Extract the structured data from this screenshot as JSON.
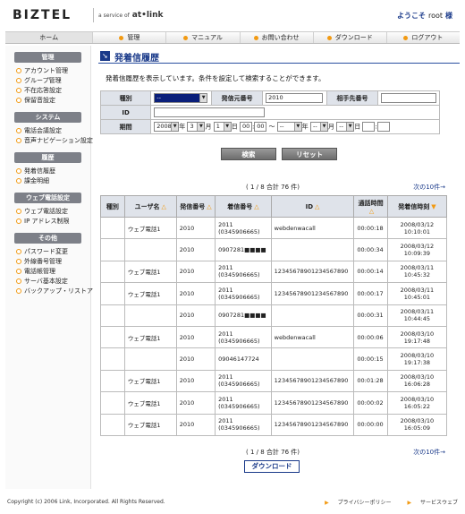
{
  "header": {
    "logo": "BIZTEL",
    "logo_sub_prefix": "a service of",
    "logo_sub_brand": "at•link",
    "welcome_prefix": "ようこそ",
    "welcome_user": "root",
    "welcome_suffix": "様"
  },
  "nav": [
    "ホーム",
    "管理",
    "マニュアル",
    "お問い合わせ",
    "ダウンロード",
    "ログアウト"
  ],
  "sidebar": {
    "sections": [
      {
        "title": "管理",
        "items": [
          "アカウント管理",
          "グループ管理",
          "不在応答設定",
          "保留音設定"
        ]
      },
      {
        "title": "システム",
        "items": [
          "電話会議設定",
          "音声ナビゲーション設定"
        ]
      },
      {
        "title": "履歴",
        "items": [
          "発着信履歴",
          "課金明細"
        ]
      },
      {
        "title": "ウェブ電話設定",
        "items": [
          "ウェブ電話設定",
          "IP アドレス制限"
        ]
      },
      {
        "title": "その他",
        "items": [
          "パスワード変更",
          "外線番号管理",
          "電話帳管理",
          "サーバ基本設定",
          "バックアップ・リストア"
        ]
      }
    ]
  },
  "page": {
    "title": "発着信履歴",
    "description": "発着信履歴を表示しています。条件を設定して検索することができます。"
  },
  "form": {
    "type_label": "種別",
    "type_value": "--",
    "caller_label": "発信元番号",
    "caller_value": "2010",
    "callee_label": "相手先番号",
    "callee_value": "",
    "id_label": "ID",
    "id_value": "",
    "period_label": "期間",
    "from_year": "2008",
    "year_unit": "年",
    "from_month": "3",
    "month_unit": "月",
    "from_day": "1",
    "day_unit": "日",
    "from_hour": "00",
    "from_min": "00",
    "time_sep": ":",
    "range_sep": "〜",
    "to_year": "--",
    "to_month": "--",
    "to_day": "--",
    "to_hour": "",
    "to_min": ""
  },
  "buttons": {
    "search": "検索",
    "reset": "リセット",
    "download": "ダウンロード"
  },
  "pagination": {
    "count": "( 1 / 8 合計 76 件)",
    "next": "次の10件→"
  },
  "table": {
    "headers": [
      "種別",
      "ユーザ名",
      "発信番号",
      "着信番号",
      "ID",
      "通話時間",
      "発着信時刻"
    ],
    "rows": [
      {
        "type": "",
        "user": "ウェブ電話1",
        "from": "2010",
        "to": "2011 (0345906665)",
        "id": "webdenwacall",
        "dur": "00:00:18",
        "time": "2008/03/12 10:10:01"
      },
      {
        "type": "",
        "user": "",
        "from": "2010",
        "to": "0907281■■■■",
        "id": "",
        "dur": "00:00:34",
        "time": "2008/03/12 10:09:39"
      },
      {
        "type": "",
        "user": "ウェブ電話1",
        "from": "2010",
        "to": "2011 (0345906665)",
        "id": "12345678901234567890",
        "dur": "00:00:14",
        "time": "2008/03/11 10:45:32"
      },
      {
        "type": "",
        "user": "ウェブ電話1",
        "from": "2010",
        "to": "2011 (0345906665)",
        "id": "12345678901234567890",
        "dur": "00:00:17",
        "time": "2008/03/11 10:45:01"
      },
      {
        "type": "",
        "user": "",
        "from": "2010",
        "to": "0907281■■■■",
        "id": "",
        "dur": "00:00:31",
        "time": "2008/03/11 10:44:45"
      },
      {
        "type": "",
        "user": "ウェブ電話1",
        "from": "2010",
        "to": "2011 (0345906665)",
        "id": "webdenwacall",
        "dur": "00:00:06",
        "time": "2008/03/10 19:17:48"
      },
      {
        "type": "",
        "user": "",
        "from": "2010",
        "to": "09046147724",
        "id": "",
        "dur": "00:00:15",
        "time": "2008/03/10 19:17:38"
      },
      {
        "type": "",
        "user": "ウェブ電話1",
        "from": "2010",
        "to": "2011 (0345906665)",
        "id": "12345678901234567890",
        "dur": "00:01:28",
        "time": "2008/03/10 16:06:28"
      },
      {
        "type": "",
        "user": "ウェブ電話1",
        "from": "2010",
        "to": "2011 (0345906665)",
        "id": "12345678901234567890",
        "dur": "00:00:02",
        "time": "2008/03/10 16:05:22"
      },
      {
        "type": "",
        "user": "ウェブ電話1",
        "from": "2010",
        "to": "2011 (0345906665)",
        "id": "12345678901234567890",
        "dur": "00:00:00",
        "time": "2008/03/10 16:05:09"
      }
    ]
  },
  "footer": {
    "copyright": "Copyright (c) 2006 Link, Incorporated. All Rights Reserved.",
    "privacy": "プライバシーポリシー",
    "service": "サービスウェブ"
  },
  "colors": {
    "accent": "#f29a12",
    "brand": "#1a3a8a"
  }
}
